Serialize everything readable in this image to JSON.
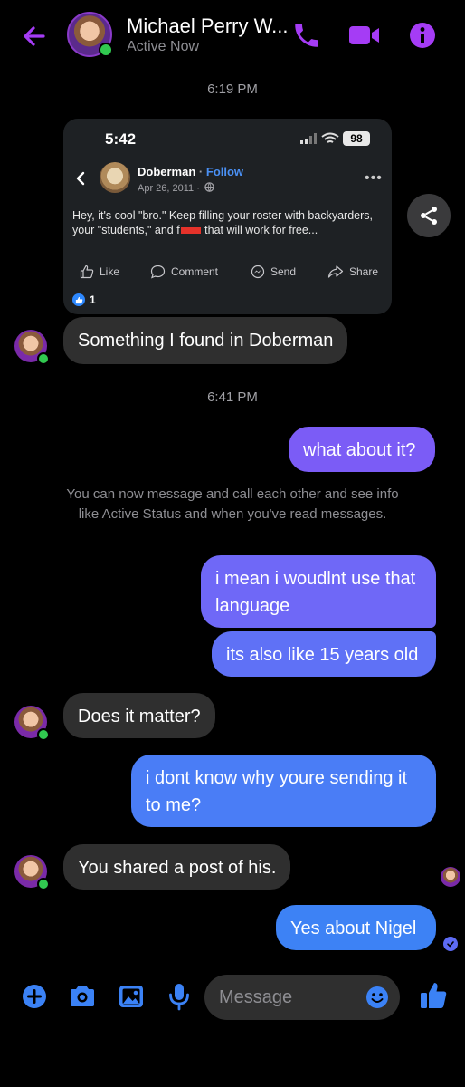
{
  "header": {
    "name": "Michael Perry W...",
    "status": "Active Now",
    "accent": "#a53cf5"
  },
  "timestamps": [
    "6:19 PM",
    "6:41 PM"
  ],
  "shared_post": {
    "phone_time": "5:42",
    "battery": "98",
    "author": "Doberman",
    "follow_label": "Follow",
    "date": "Apr 26, 2011 ·",
    "text_part1": "Hey, it's cool \"bro.\" Keep filling your roster with backyarders, your \"students,\" and f",
    "text_part2": "that will work for free...",
    "actions": [
      "Like",
      "Comment",
      "Send",
      "Share"
    ],
    "likes_count": "1"
  },
  "messages": [
    {
      "direction": "incoming",
      "text": "Something I found in Doberman"
    },
    {
      "direction": "outgoing",
      "text": "what about it?"
    },
    {
      "direction": "outgoing",
      "text": "i mean i woudlnt use that language"
    },
    {
      "direction": "outgoing",
      "text": "its also like 15 years old"
    },
    {
      "direction": "incoming",
      "text": "Does it matter?"
    },
    {
      "direction": "outgoing",
      "text": "i dont know why youre sending it to me?"
    },
    {
      "direction": "incoming",
      "text": "You shared a post of his."
    },
    {
      "direction": "outgoing",
      "text": "Yes about Nigel"
    }
  ],
  "system_note": "You can now message and call each other and see info like Active Status and when you've read messages.",
  "composer": {
    "placeholder": "Message",
    "icons": [
      "plus-icon",
      "camera-icon",
      "gallery-icon",
      "microphone-icon",
      "emoji-icon",
      "thumbs-up-icon"
    ]
  },
  "colors": {
    "outgoing_top": "#7b5cf6",
    "outgoing_bottom": "#3d82f5",
    "incoming": "#2f2f2f",
    "composer_icon": "#3b82f6"
  }
}
